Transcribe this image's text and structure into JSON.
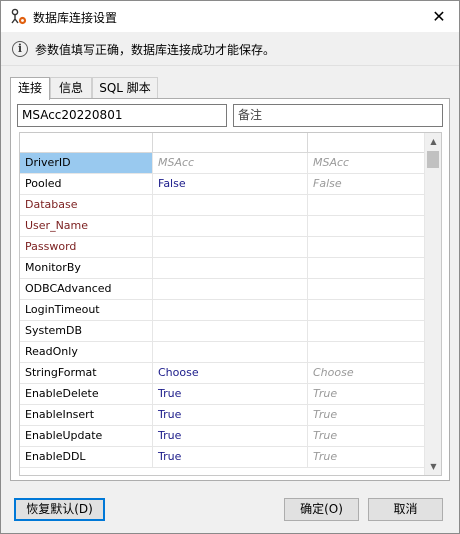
{
  "window": {
    "title": "数据库连接设置"
  },
  "info": {
    "message": "参数值填写正确，数据库连接成功才能保存。"
  },
  "tabs": [
    {
      "label": "连接"
    },
    {
      "label": "信息"
    },
    {
      "label": "SQL 脚本"
    }
  ],
  "connection": {
    "name_value": "MSAcc20220801",
    "remark_placeholder": "备注"
  },
  "grid": {
    "rows": [
      {
        "name": "DriverID",
        "value": "MSAcc",
        "default": "MSAcc",
        "required": false
      },
      {
        "name": "Pooled",
        "value": "False",
        "default": "False",
        "required": false
      },
      {
        "name": "Database",
        "value": "",
        "default": "",
        "required": true
      },
      {
        "name": "User_Name",
        "value": "",
        "default": "",
        "required": true
      },
      {
        "name": "Password",
        "value": "",
        "default": "",
        "required": true
      },
      {
        "name": "MonitorBy",
        "value": "",
        "default": "",
        "required": false
      },
      {
        "name": "ODBCAdvanced",
        "value": "",
        "default": "",
        "required": false
      },
      {
        "name": "LoginTimeout",
        "value": "",
        "default": "",
        "required": false
      },
      {
        "name": "SystemDB",
        "value": "",
        "default": "",
        "required": false
      },
      {
        "name": "ReadOnly",
        "value": "",
        "default": "",
        "required": false
      },
      {
        "name": "StringFormat",
        "value": "Choose",
        "default": "Choose",
        "required": false
      },
      {
        "name": "EnableDelete",
        "value": "True",
        "default": "True",
        "required": false
      },
      {
        "name": "EnableInsert",
        "value": "True",
        "default": "True",
        "required": false
      },
      {
        "name": "EnableUpdate",
        "value": "True",
        "default": "True",
        "required": false
      },
      {
        "name": "EnableDDL",
        "value": "True",
        "default": "True",
        "required": false
      }
    ]
  },
  "buttons": {
    "restore_default": "恢复默认(D)",
    "ok": "确定(O)",
    "cancel": "取消"
  },
  "colors": {
    "selection": "#99c9ef",
    "required_text": "#7b1f1f",
    "value_text": "#1b1b8a",
    "default_text": "#9a9a9a",
    "focus_border": "#0078d7"
  }
}
